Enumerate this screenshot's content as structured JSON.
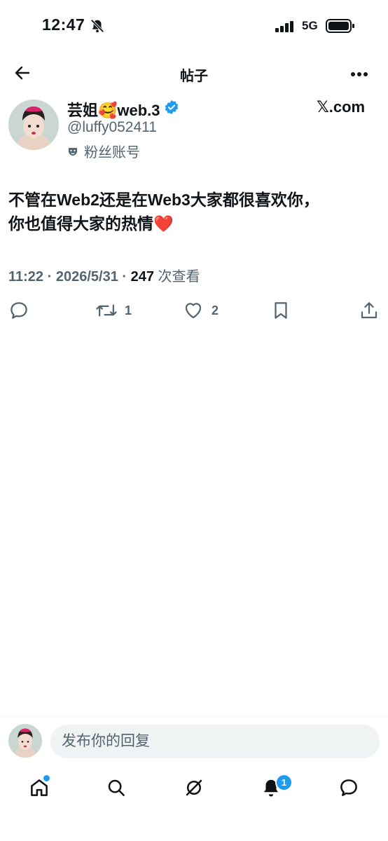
{
  "status_bar": {
    "time": "12:47",
    "network": "5G"
  },
  "header": {
    "title": "帖子"
  },
  "author": {
    "name": "芸姐🥰web.3",
    "handle": "@luffy052411",
    "label": "粉丝账号",
    "platform": "𝕏.com"
  },
  "tweet": {
    "text_line1": "不管在Web2还是在Web3大家都很喜欢你，",
    "text_line2": "你也值得大家的热情❤️",
    "time": "11:22",
    "date": "2026/5/31",
    "views": "247",
    "views_label": "次查看"
  },
  "actions": {
    "retweets": "1",
    "likes": "2"
  },
  "reply": {
    "placeholder": "发布你的回复"
  },
  "tabbar": {
    "notifications_badge": "1"
  },
  "colors": {
    "accent": "#1d9bf0",
    "secondary_text": "#536471",
    "primary_text": "#0f1419"
  },
  "icons": [
    "bell-off-icon",
    "signal-icon",
    "battery-icon",
    "back-arrow-icon",
    "more-icon",
    "verified-icon",
    "fan-mask-icon",
    "reply-icon",
    "retweet-icon",
    "like-icon",
    "bookmark-icon",
    "share-icon",
    "home-icon",
    "search-icon",
    "grok-icon",
    "notifications-icon",
    "messages-icon"
  ]
}
